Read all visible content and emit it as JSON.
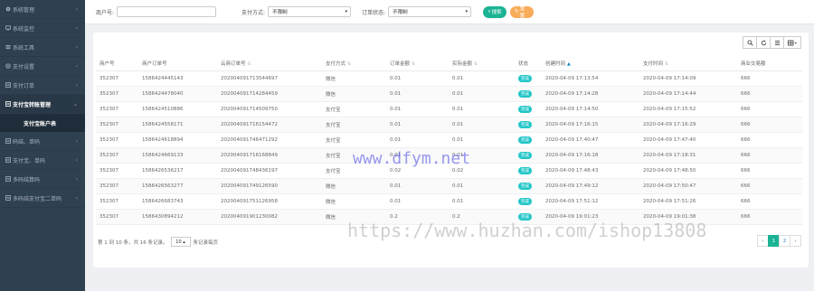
{
  "sidebar": {
    "items": [
      {
        "label": "系统管理"
      },
      {
        "label": "系统监控"
      },
      {
        "label": "系统工具"
      },
      {
        "label": "支付设置"
      },
      {
        "label": "支付订单"
      },
      {
        "label": "支付宝转账管理"
      }
    ],
    "sub_item": "支付宝账户表",
    "items2": [
      {
        "label": "码结、单码"
      },
      {
        "label": "支付宝、单码"
      },
      {
        "label": "多码结算码"
      },
      {
        "label": "多码结支付宝二单码"
      }
    ]
  },
  "filters": {
    "merchant_label": "商户号:",
    "merchant_value": "",
    "pay_method_label": "支付方式:",
    "pay_method_value": "不限制",
    "status_label": "订单状态:",
    "status_value": "不限制",
    "search_label": "搜索",
    "reset_label": "重置"
  },
  "toolbar": {
    "search_icon": "search-icon",
    "refresh_icon": "refresh-icon",
    "list_icon": "list-icon",
    "columns_icon": "columns-icon"
  },
  "table": {
    "headers": [
      "商户号",
      "商户订单号",
      "云商订单号",
      "支付方式",
      "订单金额",
      "实际金额",
      "状态",
      "创建时间",
      "支付时间",
      "商业交易额"
    ],
    "rows": [
      [
        "352307",
        "1586424445143",
        "202004091713544697",
        "微信",
        "0.01",
        "0.01",
        "完成",
        "2020-04-09 17:13:54",
        "2020-04-09 17:14:09",
        "666"
      ],
      [
        "352307",
        "1586424478040",
        "202004091714284459",
        "微信",
        "0.01",
        "0.01",
        "完成",
        "2020-04-09 17:14:28",
        "2020-04-09 17:14:44",
        "666"
      ],
      [
        "352307",
        "1586424510886",
        "202004091714509750",
        "支付宝",
        "0.01",
        "0.01",
        "完成",
        "2020-04-09 17:14:50",
        "2020-04-09 17:15:52",
        "666"
      ],
      [
        "352307",
        "1586424558171",
        "202004091716154472",
        "支付宝",
        "0.01",
        "0.01",
        "完成",
        "2020-04-09 17:16:15",
        "2020-04-09 17:16:29",
        "666"
      ],
      [
        "352307",
        "1586424618894",
        "202004091746471292",
        "支付宝",
        "0.01",
        "0.01",
        "完成",
        "2020-04-09 17:40:47",
        "2020-04-09 17:47:40",
        "666"
      ],
      [
        "352307",
        "1586424669133",
        "202004091716168849",
        "支付宝",
        "0.01",
        "0.01",
        "完成",
        "2020-04-09 17:16:18",
        "2020-04-09 17:18:31",
        "666"
      ],
      [
        "352307",
        "1586426536217",
        "202004091748436197",
        "支付宝",
        "0.02",
        "0.02",
        "完成",
        "2020-04-09 17:48:43",
        "2020-04-09 17:48:50",
        "666"
      ],
      [
        "352307",
        "1586426563277",
        "202004091749126590",
        "微信",
        "0.01",
        "0.01",
        "完成",
        "2020-04-09 17:49:12",
        "2020-04-09 17:50:47",
        "666"
      ],
      [
        "352307",
        "1586426683743",
        "202004091751126958",
        "微信",
        "0.01",
        "0.01",
        "完成",
        "2020-04-09 17:51:12",
        "2020-04-09 17:51:26",
        "666"
      ],
      [
        "352307",
        "1586430894212",
        "202004091901230082",
        "微信",
        "0.2",
        "0.2",
        "完成",
        "2020-04-09 19:01:23",
        "2020-04-09 19:01:38",
        "666"
      ]
    ]
  },
  "pager": {
    "info_prefix": "第 1 到 10 条，共 16 条记录。",
    "page_size": "10 ▴",
    "info_suffix": "条记录每页",
    "pages": [
      "‹",
      "1",
      "2",
      "›"
    ]
  },
  "watermarks": {
    "line1": "www.dfym.net",
    "line2": "https://www.huzhan.com/ishop13808"
  },
  "colors": {
    "sidebar_bg": "#2f4050",
    "accent_green": "#1ab394",
    "accent_orange": "#f8ac59",
    "badge": "#23c6c8"
  }
}
